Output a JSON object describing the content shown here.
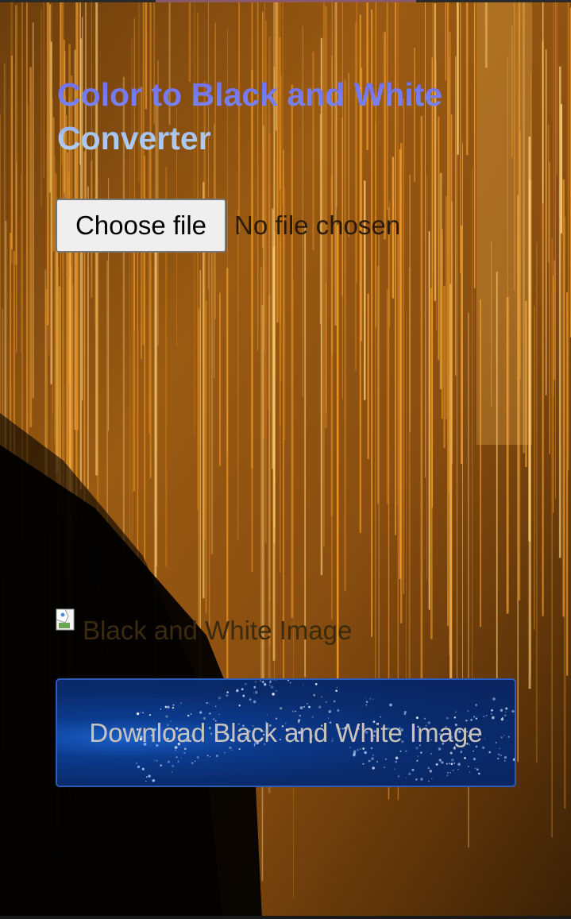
{
  "app": {
    "title": "Color to Black and White Converter"
  },
  "file_input": {
    "button_label": "Choose file",
    "status_text": "No file chosen"
  },
  "preview": {
    "alt_text": "Black and White Image",
    "icon": "broken-image-icon"
  },
  "download": {
    "label": "Download Black and White Image"
  },
  "colors": {
    "title_gradient_start": "#6f6cf0",
    "title_gradient_end": "#b6d2ef",
    "background_streaks": "#e08a1c",
    "download_button_bg": "#0c3a8c",
    "download_button_border": "#2e5bb8",
    "choose_button_bg": "#efefef"
  }
}
